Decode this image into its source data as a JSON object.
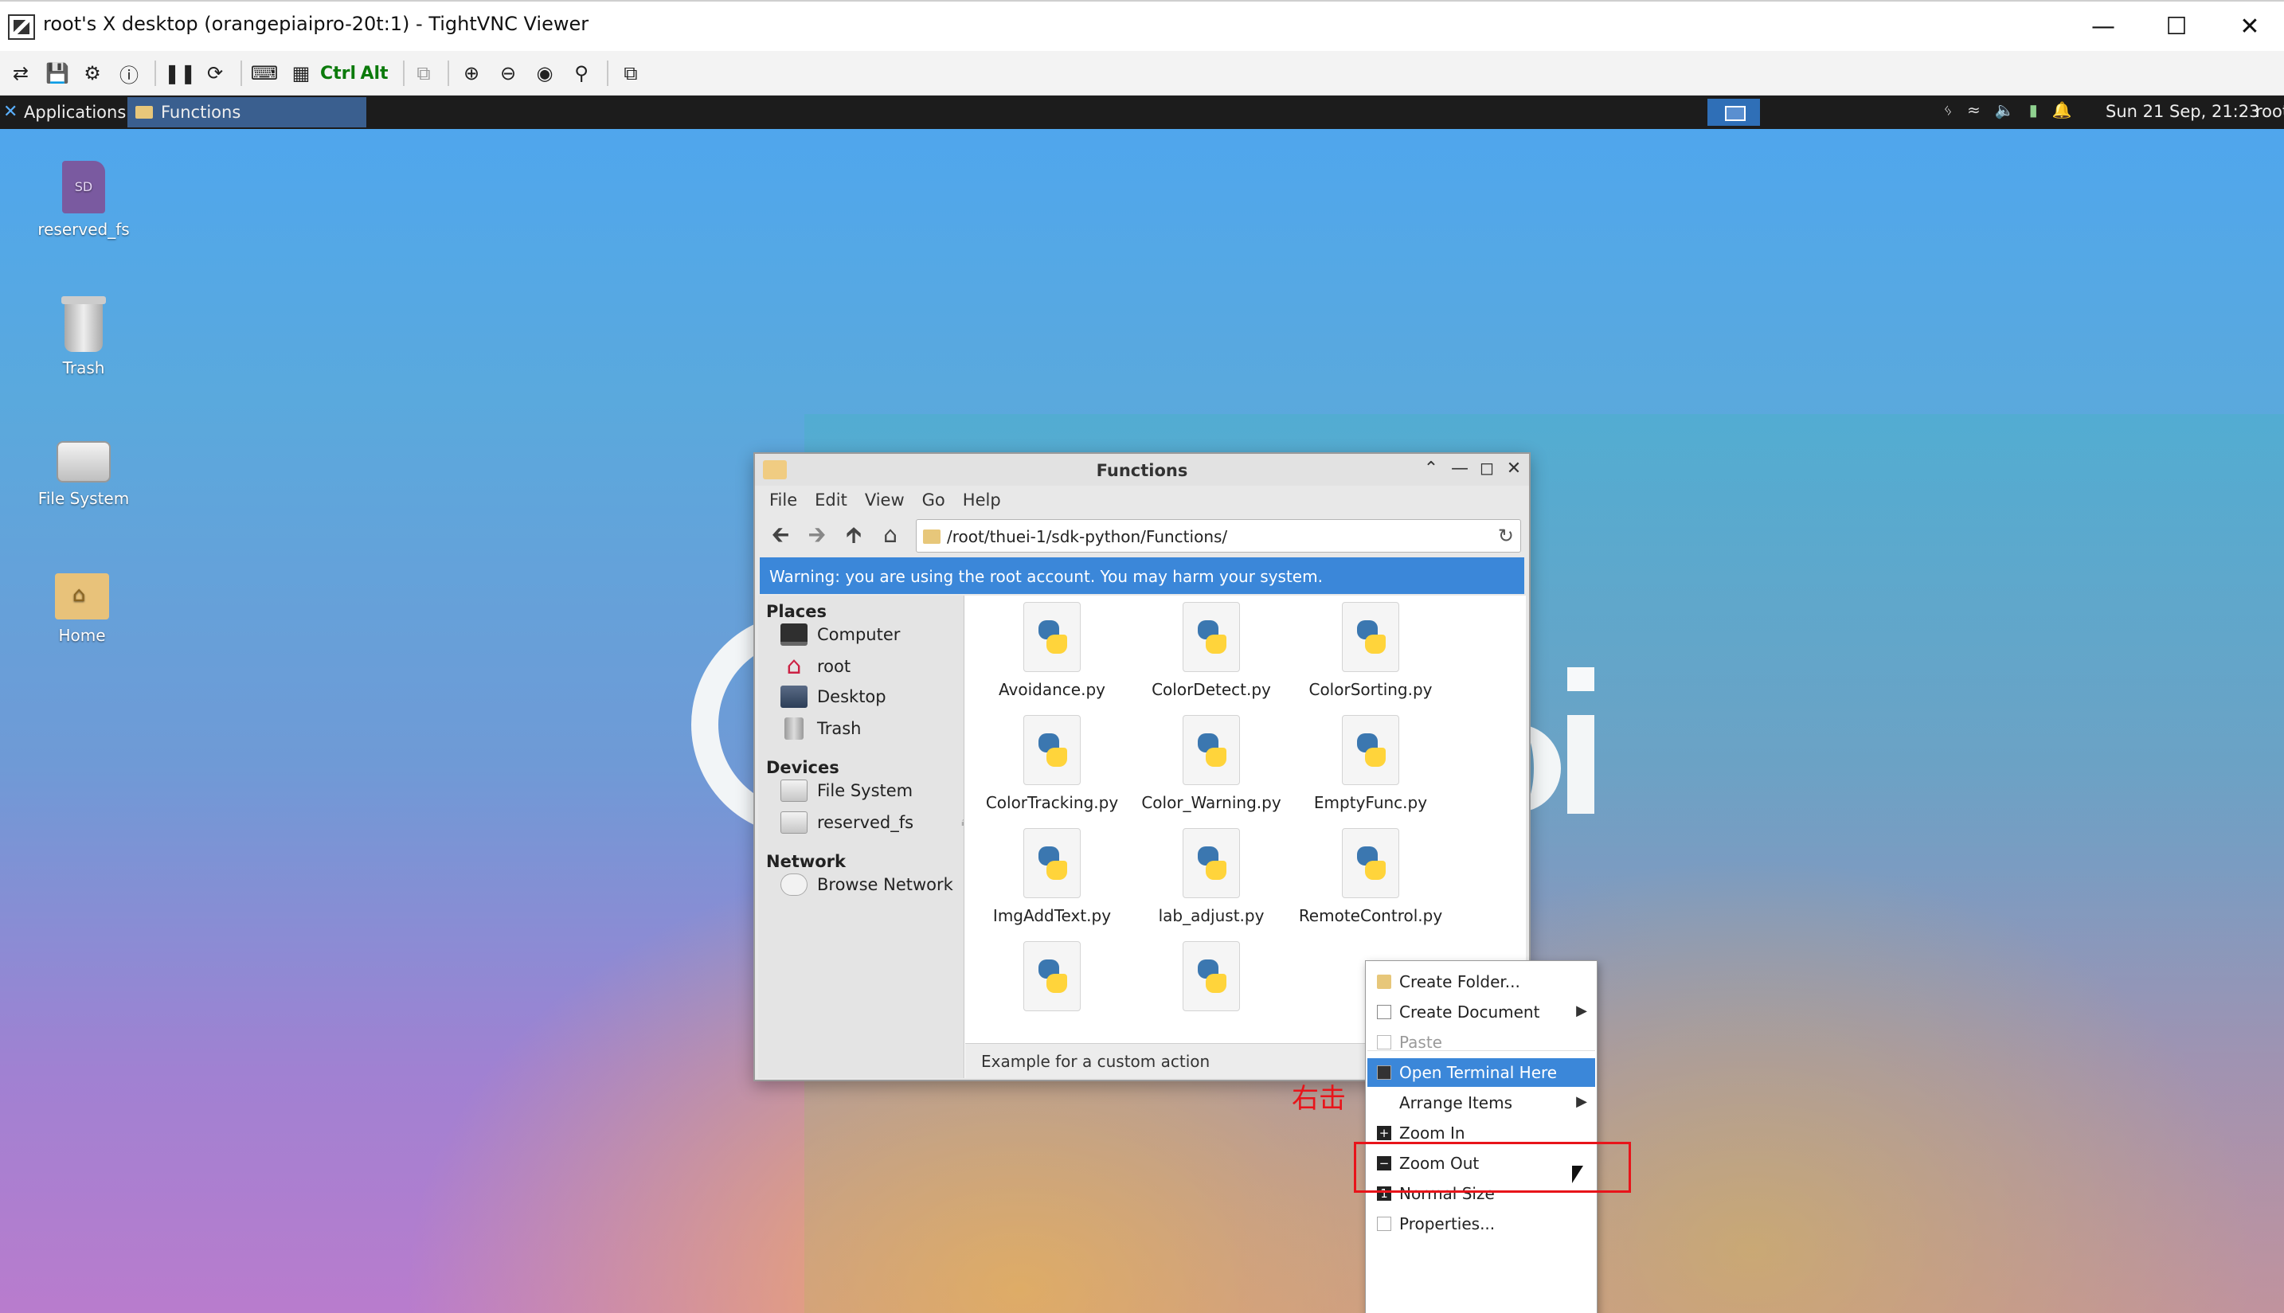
{
  "vnc": {
    "title": "root's X desktop (orangepiaipro-20t:1) - TightVNC Viewer",
    "toolbar_ctrl": "Ctrl",
    "toolbar_alt": "Alt"
  },
  "panel": {
    "applications": "Applications",
    "task_label": "Functions",
    "clock": "Sun 21 Sep, 21:23",
    "user": "root"
  },
  "desktop_icons": [
    {
      "label": "reserved_fs",
      "glyph": "SD"
    },
    {
      "label": "Trash"
    },
    {
      "label": "File System"
    },
    {
      "label": "Home"
    }
  ],
  "thunar": {
    "title": "Functions",
    "menu": [
      "File",
      "Edit",
      "View",
      "Go",
      "Help"
    ],
    "path": "/root/thuei-1/sdk-python/Functions/",
    "warning": "Warning: you are using the root account. You may harm your system.",
    "sidebar": {
      "places_header": "Places",
      "places": [
        "Computer",
        "root",
        "Desktop",
        "Trash"
      ],
      "devices_header": "Devices",
      "devices": [
        "File System",
        "reserved_fs"
      ],
      "network_header": "Network",
      "network": [
        "Browse Network"
      ]
    },
    "files": [
      "Avoidance.py",
      "ColorDetect.py",
      "ColorSorting.py",
      "ColorTracking.py",
      "Color_Warning.py",
      "EmptyFunc.py",
      "ImgAddText.py",
      "lab_adjust.py",
      "RemoteControl.py",
      "",
      ""
    ],
    "status": "Example for a custom action"
  },
  "context_menu": {
    "items": [
      {
        "label": "Create Folder...",
        "icon": "folder-icon"
      },
      {
        "label": "Create Document",
        "icon": "document-icon",
        "submenu": true
      },
      {
        "label": "Paste",
        "icon": "paste-icon",
        "disabled": true
      },
      {
        "label": "Open Terminal Here",
        "icon": "terminal-icon",
        "highlighted": true
      },
      {
        "label": "Arrange Items",
        "submenu": true
      },
      {
        "label": "Zoom In",
        "icon": "zoom-in-icon"
      },
      {
        "label": "Zoom Out",
        "icon": "zoom-out-icon"
      },
      {
        "label": "Normal Size",
        "icon": "normal-size-icon"
      },
      {
        "label": "Properties...",
        "icon": "properties-icon"
      }
    ]
  },
  "annotation": {
    "text": "右击",
    "color": "#e8141a"
  },
  "colors": {
    "highlight": "#3b87d9",
    "panel": "#1c1c1c"
  }
}
